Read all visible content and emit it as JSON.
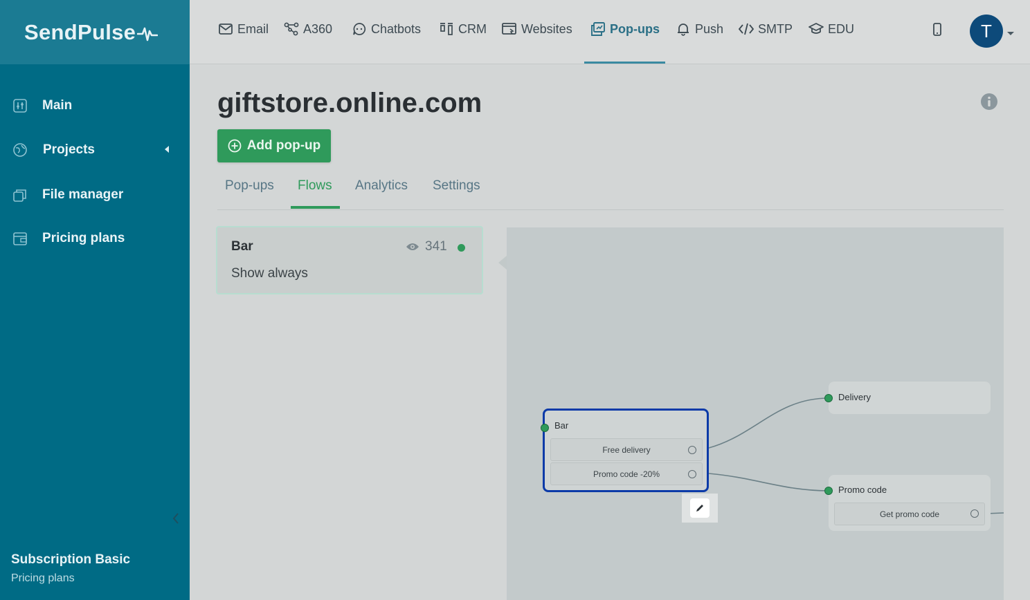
{
  "brand": {
    "name": "SendPulse"
  },
  "sidebar": {
    "items": [
      {
        "label": "Main",
        "icon": "dashboard-icon"
      },
      {
        "label": "Projects",
        "icon": "globe-icon"
      },
      {
        "label": "File manager",
        "icon": "files-icon"
      },
      {
        "label": "Pricing plans",
        "icon": "wallet-icon"
      }
    ],
    "subscription": {
      "title": "Subscription Basic",
      "link": "Pricing plans"
    }
  },
  "topnav": {
    "items": [
      {
        "label": "Email",
        "icon": "mail-icon"
      },
      {
        "label": "A360",
        "icon": "nodes-icon"
      },
      {
        "label": "Chatbots",
        "icon": "chat-icon"
      },
      {
        "label": "CRM",
        "icon": "kanban-icon"
      },
      {
        "label": "Websites",
        "icon": "website-icon"
      },
      {
        "label": "Pop-ups",
        "icon": "popup-icon"
      },
      {
        "label": "Push",
        "icon": "bell-icon"
      },
      {
        "label": "SMTP",
        "icon": "code-icon"
      },
      {
        "label": "EDU",
        "icon": "graduation-cap-icon"
      }
    ],
    "active": "Pop-ups",
    "avatar_initial": "T"
  },
  "page": {
    "title": "giftstore.online.com",
    "add_button": "Add pop-up",
    "tabs": [
      "Pop-ups",
      "Flows",
      "Analytics",
      "Settings"
    ],
    "active_tab": "Flows"
  },
  "flow_card": {
    "name": "Bar",
    "views": "341",
    "subtitle": "Show always",
    "status_color": "#2f9a5b"
  },
  "flow_canvas": {
    "nodes": {
      "bar": {
        "title": "Bar",
        "buttons": [
          "Free delivery",
          "Promo code -20%"
        ]
      },
      "delivery": {
        "title": "Delivery"
      },
      "promo": {
        "title": "Promo code",
        "buttons": [
          "Get promo code"
        ]
      }
    }
  },
  "colors": {
    "sidebar": "#006b85",
    "accent_green": "#2f9a5b",
    "active_nav": "#2a6f86",
    "selected_node_border": "#0b3aa8",
    "avatar": "#0d4a7a"
  }
}
